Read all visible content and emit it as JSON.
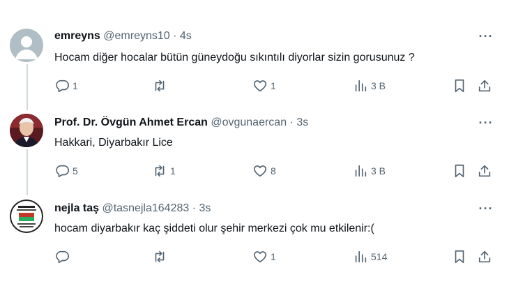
{
  "tweets": [
    {
      "name": "emreyns",
      "handle": "@emreyns10",
      "dot": "·",
      "time": "4s",
      "text": "Hocam diğer hocalar bütün güneydoğu sıkıntılı diyorlar sizin gorusunuz ?",
      "replies": "1",
      "retweets": "",
      "likes": "1",
      "views": "3 B",
      "avatar": "default-avatar-icon"
    },
    {
      "name": "Prof. Dr. Övgün Ahmet Ercan",
      "handle": "@ovgunaercan",
      "dot": "·",
      "time": "3s",
      "text": "Hakkari, Diyarbakır Lice",
      "replies": "5",
      "retweets": "1",
      "likes": "8",
      "views": "3 B",
      "avatar": "profile-photo"
    },
    {
      "name": "nejla taş",
      "handle": "@tasnejla164283",
      "dot": "·",
      "time": "3s",
      "text": "hocam diyarbakır kaç şiddeti olur şehir merkezi çok mu etkilenir:(",
      "replies": "",
      "retweets": "",
      "likes": "1",
      "views": "514",
      "avatar": "logo-avatar"
    }
  ],
  "more_label": "···",
  "colors": {
    "text": "#0f1419",
    "secondary": "#536471",
    "thread_line": "#cfd9de"
  }
}
